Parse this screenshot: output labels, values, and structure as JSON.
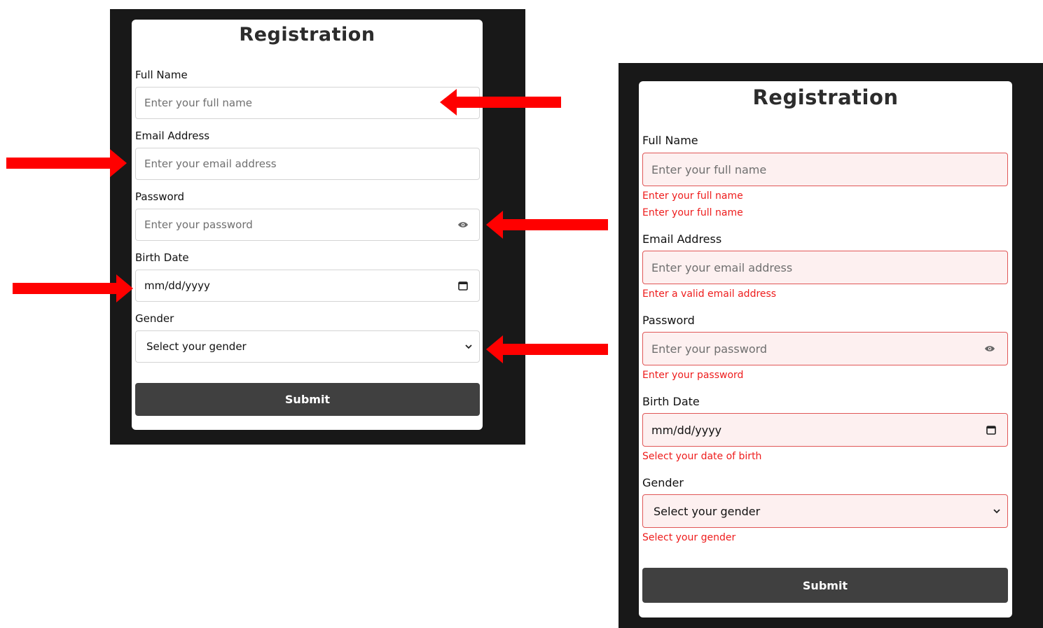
{
  "form": {
    "title": "Registration",
    "full_name": {
      "label": "Full Name",
      "placeholder": "Enter your full name"
    },
    "email": {
      "label": "Email Address",
      "placeholder": "Enter your email address"
    },
    "password": {
      "label": "Password",
      "placeholder": "Enter your password"
    },
    "birth_date": {
      "label": "Birth Date",
      "value": "mm/dd/yyyy"
    },
    "gender": {
      "label": "Gender",
      "value": "Select your gender"
    },
    "submit_label": "Submit"
  },
  "errors": {
    "full_name": [
      "Enter your full name",
      "Enter your full name"
    ],
    "email": "Enter a valid email address",
    "password": "Enter your password",
    "birth_date": "Select your date of birth",
    "gender": "Select your gender"
  },
  "colors": {
    "panel_bg": "#181818",
    "error_text": "#ee1c1c",
    "error_border": "#e05757",
    "error_fill": "#fdf0f0",
    "submit_bg": "#404040",
    "arrow": "#ff0000"
  },
  "icons": {
    "password_toggle": "eye-icon",
    "birth_date": "calendar-icon",
    "gender": "chevron-down-icon"
  }
}
